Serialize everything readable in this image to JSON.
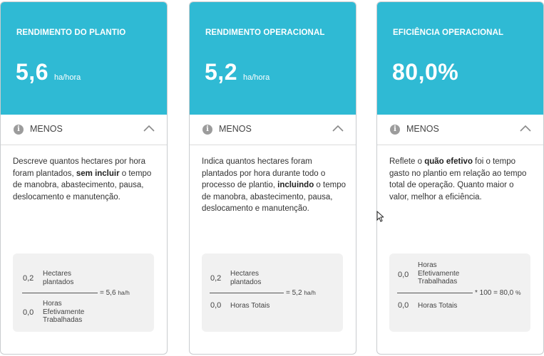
{
  "cards": [
    {
      "title": "RENDIMENTO DO PLANTIO",
      "value": "5,6",
      "unit": "ha/hora",
      "toggle_label": "MENOS",
      "description": [
        {
          "text": "Descreve quantos hectares por hora foram plantados, ",
          "bold": false
        },
        {
          "text": "sem incluir",
          "bold": true
        },
        {
          "text": " o tempo de manobra, abastecimento, pausa, deslocamento e manutenção.",
          "bold": false
        }
      ],
      "formula": {
        "numerator_value": "0,2",
        "numerator_label": "Hectares plantados",
        "denominator_value": "0,0",
        "denominator_label": "Horas Efetivamente Trabalhadas",
        "result_text": "= 5,6",
        "result_unit": "ha/h"
      }
    },
    {
      "title": "RENDIMENTO OPERACIONAL",
      "value": "5,2",
      "unit": "ha/hora",
      "toggle_label": "MENOS",
      "description": [
        {
          "text": "Indica quantos hectares foram plantados por hora durante todo o processo de plantio, ",
          "bold": false
        },
        {
          "text": "incluindo",
          "bold": true
        },
        {
          "text": " o tempo de manobra, abastecimento, pausa, deslocamento e manutenção.",
          "bold": false
        }
      ],
      "formula": {
        "numerator_value": "0,2",
        "numerator_label": "Hectares plantados",
        "denominator_value": "0,0",
        "denominator_label": "Horas Totais",
        "result_text": "= 5,2",
        "result_unit": "ha/h"
      }
    },
    {
      "title": "EFICIÊNCIA OPERACIONAL",
      "value": "80,0%",
      "unit": "",
      "toggle_label": "MENOS",
      "description": [
        {
          "text": "Reflete o ",
          "bold": false
        },
        {
          "text": "quão efetivo",
          "bold": true
        },
        {
          "text": " foi o tempo gasto no plantio em relação ao tempo total de operação. Quanto maior o valor, melhor a eficiência.",
          "bold": false
        }
      ],
      "formula": {
        "numerator_value": "0,0",
        "numerator_label": "Horas Efetivamente Trabalhadas",
        "denominator_value": "0,0",
        "denominator_label": "Horas Totais",
        "result_text": "* 100 = 80,0",
        "result_unit": "%"
      }
    }
  ],
  "icons": {
    "info": "info-icon",
    "collapse": "chevron-up-icon",
    "cursor": "mouse-pointer-icon"
  },
  "colors": {
    "header": "#2fbad4",
    "formula_bg": "#f1f1f1",
    "border": "#c9cccf"
  }
}
